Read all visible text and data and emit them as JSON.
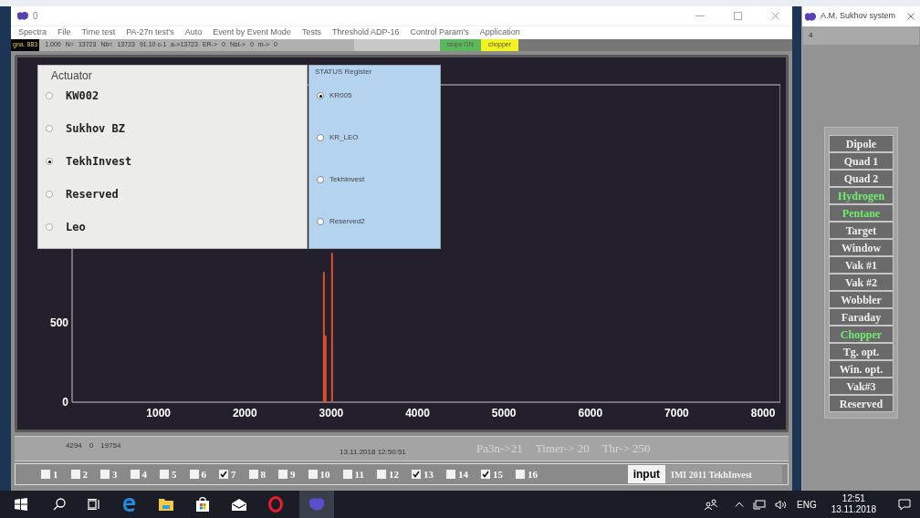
{
  "window": {
    "title": "0"
  },
  "menu": [
    "Spectra",
    "File",
    "Time test",
    "PA-27n test's",
    "Auto",
    "Event by Event Mode",
    "Tests",
    "Threshold ADP-16",
    "Control Param's",
    "Application"
  ],
  "status_strip": {
    "label": "gna. 883",
    "readings": [
      "1.000",
      "N=",
      "13723",
      "Nb=",
      "13723",
      "91.10 c-1",
      "a->13723",
      "ER->",
      "0",
      "Nst->",
      "0",
      "m->",
      "0"
    ],
    "tags": [
      {
        "text": "stops ON",
        "color": "#5cb85c"
      },
      {
        "text": "chopper",
        "color": "#f2f21c"
      }
    ]
  },
  "chart": {
    "chart_data": {
      "type": "bar",
      "x": [
        2915,
        2935,
        3010
      ],
      "values": [
        820,
        420,
        940
      ],
      "xlim": [
        0,
        8200
      ],
      "ylim": [
        0,
        2000
      ],
      "xticks": [
        1000,
        2000,
        3000,
        4000,
        5000,
        6000,
        7000,
        8000
      ],
      "yticks": [
        0,
        500
      ]
    }
  },
  "actuator": {
    "title": "Actuator",
    "options": [
      {
        "label": "KW002",
        "selected": false
      },
      {
        "label": "Sukhov BZ",
        "selected": false
      },
      {
        "label": "TekhInvest",
        "selected": true
      },
      {
        "label": "Reserved",
        "selected": false
      },
      {
        "label": "Leo",
        "selected": false
      }
    ]
  },
  "status_register": {
    "title": "STATUS Register",
    "options": [
      {
        "label": "KR005",
        "selected": true
      },
      {
        "label": "KR_LEO",
        "selected": false
      },
      {
        "label": "TekhInvest",
        "selected": false
      },
      {
        "label": "Reserved2",
        "selected": false
      }
    ]
  },
  "info_bar": {
    "counts": [
      "4294",
      "0",
      "19754"
    ],
    "timestamp": "13.11.2018 12:50:51",
    "params": [
      "Pa3n->21",
      "Timer-> 20",
      "Thr-> 250"
    ]
  },
  "channels": [
    {
      "label": "1",
      "checked": false
    },
    {
      "label": "2",
      "checked": false
    },
    {
      "label": "3",
      "checked": false
    },
    {
      "label": "4",
      "checked": false
    },
    {
      "label": "5",
      "checked": false
    },
    {
      "label": "6",
      "checked": false
    },
    {
      "label": "7",
      "checked": true
    },
    {
      "label": "8",
      "checked": false
    },
    {
      "label": "9",
      "checked": false
    },
    {
      "label": "10",
      "checked": false
    },
    {
      "label": "11",
      "checked": false
    },
    {
      "label": "12",
      "checked": false
    },
    {
      "label": "13",
      "checked": true
    },
    {
      "label": "14",
      "checked": false
    },
    {
      "label": "15",
      "checked": true
    },
    {
      "label": "16",
      "checked": false
    }
  ],
  "input_button": "input",
  "credit": "IMI 2011 TekhInvest",
  "side_window": {
    "title": "A.M. Sukhov system",
    "field": "4",
    "items": [
      {
        "label": "Dipole",
        "on": false
      },
      {
        "label": "Quad 1",
        "on": false
      },
      {
        "label": "Quad 2",
        "on": false
      },
      {
        "label": "Hydrogen",
        "on": true
      },
      {
        "label": "Pentane",
        "on": true
      },
      {
        "label": "Target",
        "on": false
      },
      {
        "label": "Window",
        "on": false
      },
      {
        "label": "Vak #1",
        "on": false
      },
      {
        "label": "Vak #2",
        "on": false
      },
      {
        "label": "Wobbler",
        "on": false
      },
      {
        "label": "Faraday",
        "on": false
      },
      {
        "label": "Chopper",
        "on": true
      },
      {
        "label": "Tg. opt.",
        "on": false
      },
      {
        "label": "Win. opt.",
        "on": false
      },
      {
        "label": "Vak#3",
        "on": false
      },
      {
        "label": "Reserved",
        "on": false
      }
    ]
  },
  "taskbar": {
    "language": "ENG",
    "time": "12:51",
    "date": "13.11.2018"
  }
}
